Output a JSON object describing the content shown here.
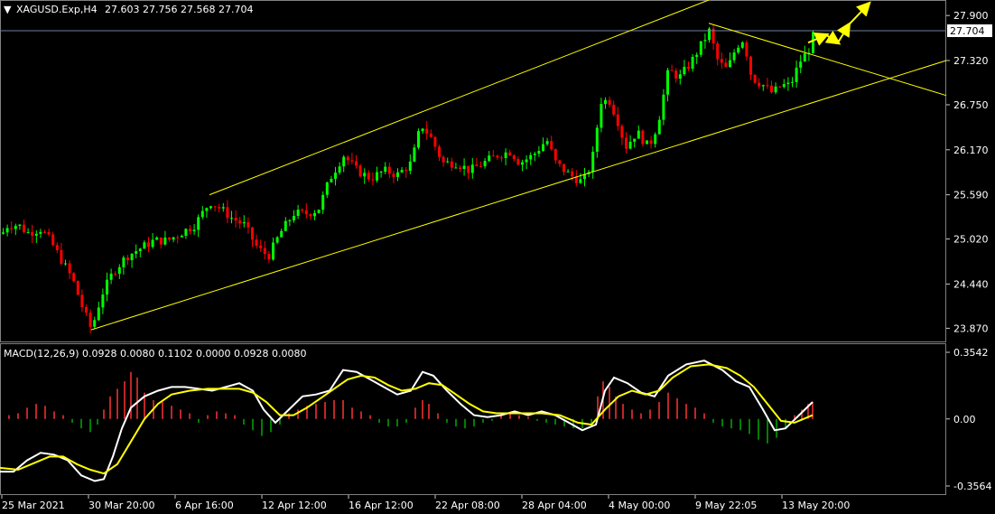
{
  "header": {
    "symbol": "XAGUSD.Exp,H4",
    "ohlc": "27.603 27.756 27.568 27.704",
    "menu_glyph": "▼"
  },
  "macd_header": "MACD(12,26,9) 0.0928 0.0080 0.1102 0.0000 0.0928 0.0080",
  "colors": {
    "background": "#000000",
    "bull_candle": "#00ff00",
    "bear_candle": "#ff0000",
    "trendline": "#ffff00",
    "macd_main": "#ffffff",
    "macd_signal": "#ffff00",
    "hist_pos": "#ff3333",
    "hist_neg": "#00aa00",
    "axis": "#c8c8c8",
    "price_line": "#7080a0"
  },
  "chart_data": [
    {
      "type": "candlestick",
      "title": "XAGUSD.Exp,H4",
      "current_price": "27.704",
      "y_ticks": [
        "27.900",
        "27.320",
        "26.750",
        "26.170",
        "25.590",
        "25.020",
        "24.440",
        "23.870"
      ],
      "ylim": [
        23.7,
        28.1
      ],
      "x_ticks": [
        "25 Mar 2021",
        "30 Mar 20:00",
        "6 Apr 16:00",
        "12 Apr 12:00",
        "16 Apr 12:00",
        "22 Apr 08:00",
        "28 Apr 04:00",
        "4 May 00:00",
        "9 May 22:05",
        "13 May 20:00"
      ],
      "price_path": [
        [
          0,
          25.05
        ],
        [
          8,
          25.2
        ],
        [
          20,
          25.2
        ],
        [
          30,
          25.1
        ],
        [
          45,
          25.15
        ],
        [
          55,
          25.0
        ],
        [
          65,
          24.8
        ],
        [
          80,
          24.5
        ],
        [
          92,
          24.1
        ],
        [
          101,
          23.85
        ],
        [
          112,
          24.3
        ],
        [
          125,
          24.6
        ],
        [
          140,
          24.8
        ],
        [
          155,
          24.9
        ],
        [
          170,
          25.0
        ],
        [
          185,
          25.0
        ],
        [
          200,
          25.1
        ],
        [
          215,
          25.2
        ],
        [
          232,
          25.5
        ],
        [
          245,
          25.4
        ],
        [
          255,
          25.3
        ],
        [
          270,
          25.2
        ],
        [
          285,
          24.9
        ],
        [
          297,
          24.8
        ],
        [
          310,
          25.1
        ],
        [
          325,
          25.35
        ],
        [
          340,
          25.35
        ],
        [
          352,
          25.4
        ],
        [
          365,
          25.8
        ],
        [
          380,
          26.1
        ],
        [
          395,
          25.9
        ],
        [
          410,
          25.8
        ],
        [
          425,
          25.9
        ],
        [
          440,
          25.85
        ],
        [
          455,
          26.0
        ],
        [
          466,
          26.5
        ],
        [
          478,
          26.3
        ],
        [
          490,
          26.0
        ],
        [
          505,
          26.0
        ],
        [
          520,
          25.9
        ],
        [
          535,
          26.0
        ],
        [
          550,
          26.1
        ],
        [
          565,
          26.15
        ],
        [
          575,
          26.0
        ],
        [
          590,
          26.1
        ],
        [
          605,
          26.3
        ],
        [
          615,
          26.0
        ],
        [
          630,
          25.85
        ],
        [
          645,
          25.75
        ],
        [
          655,
          26.0
        ],
        [
          665,
          26.8
        ],
        [
          675,
          26.8
        ],
        [
          685,
          26.5
        ],
        [
          692,
          26.2
        ],
        [
          705,
          26.4
        ],
        [
          718,
          26.2
        ],
        [
          728,
          26.5
        ],
        [
          740,
          27.2
        ],
        [
          752,
          27.1
        ],
        [
          765,
          27.3
        ],
        [
          775,
          27.5
        ],
        [
          785,
          27.7
        ],
        [
          795,
          27.3
        ],
        [
          805,
          27.2
        ],
        [
          815,
          27.5
        ],
        [
          823,
          27.6
        ],
        [
          832,
          27.1
        ],
        [
          845,
          27.0
        ],
        [
          855,
          26.9
        ],
        [
          865,
          27.0
        ],
        [
          875,
          27.0
        ],
        [
          885,
          27.3
        ],
        [
          895,
          27.45
        ],
        [
          902,
          27.7
        ]
      ],
      "annotations": [
        {
          "type": "trendline",
          "label": "channel upper",
          "from": [
            232,
            25.59
          ],
          "to": [
            785,
            28.1
          ]
        },
        {
          "type": "trendline",
          "label": "channel lower",
          "from": [
            101,
            23.85
          ],
          "to": [
            1048,
            27.32
          ]
        },
        {
          "type": "trendline",
          "label": "descending line",
          "from": [
            785,
            27.8
          ],
          "to": [
            1048,
            26.87
          ]
        },
        {
          "type": "arrow",
          "label": "forecast path",
          "points": [
            [
              895,
              27.55
            ],
            [
              915,
              27.65
            ],
            [
              928,
              27.55
            ],
            [
              940,
              27.78
            ],
            [
              962,
              28.05
            ]
          ]
        }
      ]
    },
    {
      "type": "line",
      "title": "MACD(12,26,9)",
      "y_ticks": [
        "0.3542",
        "0.00",
        "-0.3564"
      ],
      "ylim": [
        -0.3564,
        0.3542
      ],
      "series": [
        {
          "role": "main",
          "points": [
            [
              0,
              -0.28
            ],
            [
              15,
              -0.28
            ],
            [
              30,
              -0.22
            ],
            [
              45,
              -0.18
            ],
            [
              60,
              -0.19
            ],
            [
              75,
              -0.22
            ],
            [
              90,
              -0.3
            ],
            [
              105,
              -0.33
            ],
            [
              115,
              -0.32
            ],
            [
              125,
              -0.2
            ],
            [
              135,
              -0.05
            ],
            [
              145,
              0.06
            ],
            [
              160,
              0.12
            ],
            [
              175,
              0.15
            ],
            [
              190,
              0.17
            ],
            [
              205,
              0.17
            ],
            [
              220,
              0.16
            ],
            [
              235,
              0.15
            ],
            [
              250,
              0.17
            ],
            [
              265,
              0.19
            ],
            [
              280,
              0.15
            ],
            [
              292,
              0.05
            ],
            [
              305,
              -0.02
            ],
            [
              320,
              0.05
            ],
            [
              335,
              0.12
            ],
            [
              350,
              0.13
            ],
            [
              365,
              0.15
            ],
            [
              380,
              0.26
            ],
            [
              395,
              0.25
            ],
            [
              410,
              0.21
            ],
            [
              425,
              0.17
            ],
            [
              440,
              0.13
            ],
            [
              455,
              0.15
            ],
            [
              468,
              0.25
            ],
            [
              480,
              0.23
            ],
            [
              495,
              0.15
            ],
            [
              510,
              0.08
            ],
            [
              525,
              0.02
            ],
            [
              540,
              0.01
            ],
            [
              555,
              0.02
            ],
            [
              570,
              0.04
            ],
            [
              585,
              0.02
            ],
            [
              600,
              0.04
            ],
            [
              615,
              0.02
            ],
            [
              630,
              -0.02
            ],
            [
              645,
              -0.06
            ],
            [
              660,
              -0.03
            ],
            [
              670,
              0.15
            ],
            [
              680,
              0.22
            ],
            [
              695,
              0.19
            ],
            [
              710,
              0.14
            ],
            [
              725,
              0.12
            ],
            [
              740,
              0.23
            ],
            [
              760,
              0.29
            ],
            [
              780,
              0.31
            ],
            [
              800,
              0.26
            ],
            [
              815,
              0.2
            ],
            [
              830,
              0.17
            ],
            [
              845,
              0.05
            ],
            [
              858,
              -0.06
            ],
            [
              870,
              -0.05
            ],
            [
              885,
              0.02
            ],
            [
              900,
              0.09
            ]
          ]
        },
        {
          "role": "signal",
          "points": [
            [
              0,
              -0.26
            ],
            [
              20,
              -0.27
            ],
            [
              40,
              -0.23
            ],
            [
              55,
              -0.2
            ],
            [
              70,
              -0.2
            ],
            [
              85,
              -0.24
            ],
            [
              100,
              -0.27
            ],
            [
              115,
              -0.29
            ],
            [
              130,
              -0.24
            ],
            [
              145,
              -0.12
            ],
            [
              160,
              0.0
            ],
            [
              175,
              0.08
            ],
            [
              190,
              0.13
            ],
            [
              210,
              0.15
            ],
            [
              230,
              0.16
            ],
            [
              250,
              0.16
            ],
            [
              265,
              0.16
            ],
            [
              280,
              0.14
            ],
            [
              295,
              0.09
            ],
            [
              310,
              0.02
            ],
            [
              325,
              0.02
            ],
            [
              340,
              0.06
            ],
            [
              355,
              0.11
            ],
            [
              370,
              0.16
            ],
            [
              385,
              0.21
            ],
            [
              400,
              0.23
            ],
            [
              415,
              0.22
            ],
            [
              430,
              0.18
            ],
            [
              445,
              0.15
            ],
            [
              460,
              0.16
            ],
            [
              475,
              0.19
            ],
            [
              490,
              0.18
            ],
            [
              505,
              0.13
            ],
            [
              520,
              0.08
            ],
            [
              535,
              0.04
            ],
            [
              550,
              0.03
            ],
            [
              565,
              0.03
            ],
            [
              580,
              0.03
            ],
            [
              600,
              0.03
            ],
            [
              620,
              0.02
            ],
            [
              640,
              -0.02
            ],
            [
              655,
              -0.03
            ],
            [
              670,
              0.05
            ],
            [
              685,
              0.12
            ],
            [
              700,
              0.15
            ],
            [
              715,
              0.13
            ],
            [
              730,
              0.15
            ],
            [
              745,
              0.22
            ],
            [
              765,
              0.28
            ],
            [
              785,
              0.29
            ],
            [
              805,
              0.27
            ],
            [
              820,
              0.23
            ],
            [
              835,
              0.17
            ],
            [
              850,
              0.08
            ],
            [
              865,
              -0.01
            ],
            [
              880,
              -0.02
            ],
            [
              900,
              0.02
            ]
          ]
        }
      ],
      "histogram": [
        [
          10,
          0.02
        ],
        [
          20,
          0.03
        ],
        [
          30,
          0.06
        ],
        [
          40,
          0.08
        ],
        [
          50,
          0.07
        ],
        [
          60,
          0.04
        ],
        [
          70,
          0.02
        ],
        [
          80,
          -0.02
        ],
        [
          90,
          -0.05
        ],
        [
          100,
          -0.07
        ],
        [
          108,
          -0.03
        ],
        [
          115,
          0.05
        ],
        [
          122,
          0.12
        ],
        [
          130,
          0.16
        ],
        [
          138,
          0.2
        ],
        [
          145,
          0.25
        ],
        [
          152,
          0.22
        ],
        [
          160,
          0.14
        ],
        [
          170,
          0.1
        ],
        [
          180,
          0.09
        ],
        [
          190,
          0.07
        ],
        [
          200,
          0.05
        ],
        [
          210,
          0.03
        ],
        [
          220,
          -0.02
        ],
        [
          230,
          0.02
        ],
        [
          240,
          0.04
        ],
        [
          250,
          0.03
        ],
        [
          260,
          0.02
        ],
        [
          270,
          -0.03
        ],
        [
          280,
          -0.06
        ],
        [
          290,
          -0.09
        ],
        [
          300,
          -0.07
        ],
        [
          310,
          -0.03
        ],
        [
          320,
          0.03
        ],
        [
          330,
          0.05
        ],
        [
          340,
          0.07
        ],
        [
          350,
          0.08
        ],
        [
          360,
          0.09
        ],
        [
          370,
          0.1
        ],
        [
          380,
          0.1
        ],
        [
          390,
          0.06
        ],
        [
          400,
          0.04
        ],
        [
          410,
          0.02
        ],
        [
          420,
          -0.02
        ],
        [
          430,
          -0.04
        ],
        [
          440,
          -0.04
        ],
        [
          450,
          -0.02
        ],
        [
          460,
          0.06
        ],
        [
          468,
          0.1
        ],
        [
          475,
          0.08
        ],
        [
          485,
          0.03
        ],
        [
          495,
          -0.02
        ],
        [
          505,
          -0.04
        ],
        [
          515,
          -0.05
        ],
        [
          525,
          -0.04
        ],
        [
          535,
          -0.02
        ],
        [
          545,
          -0.01
        ],
        [
          555,
          0.02
        ],
        [
          565,
          0.03
        ],
        [
          575,
          0.02
        ],
        [
          585,
          0.01
        ],
        [
          595,
          -0.01
        ],
        [
          605,
          -0.02
        ],
        [
          615,
          -0.03
        ],
        [
          625,
          -0.04
        ],
        [
          635,
          -0.05
        ],
        [
          645,
          -0.05
        ],
        [
          655,
          -0.03
        ],
        [
          662,
          0.12
        ],
        [
          668,
          0.2
        ],
        [
          675,
          0.17
        ],
        [
          682,
          0.12
        ],
        [
          690,
          0.08
        ],
        [
          700,
          0.05
        ],
        [
          710,
          0.03
        ],
        [
          720,
          0.05
        ],
        [
          730,
          0.09
        ],
        [
          740,
          0.14
        ],
        [
          750,
          0.11
        ],
        [
          760,
          0.08
        ],
        [
          770,
          0.06
        ],
        [
          780,
          0.03
        ],
        [
          790,
          -0.02
        ],
        [
          800,
          -0.04
        ],
        [
          810,
          -0.05
        ],
        [
          820,
          -0.06
        ],
        [
          830,
          -0.08
        ],
        [
          840,
          -0.11
        ],
        [
          850,
          -0.13
        ],
        [
          860,
          -0.1
        ],
        [
          870,
          -0.05
        ],
        [
          880,
          0.02
        ],
        [
          888,
          0.05
        ],
        [
          895,
          0.08
        ],
        [
          900,
          0.09
        ]
      ]
    }
  ]
}
